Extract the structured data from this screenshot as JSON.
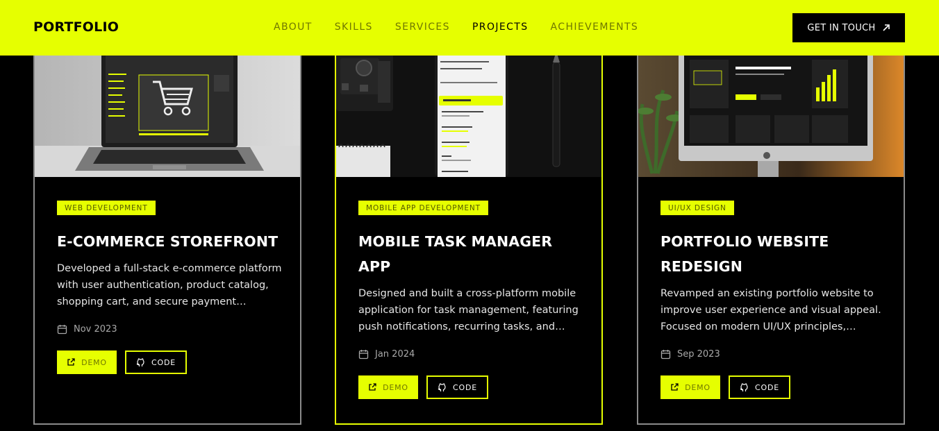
{
  "header": {
    "logo": "PORTFOLIO",
    "nav": [
      {
        "label": "ABOUT",
        "active": false
      },
      {
        "label": "SKILLS",
        "active": false
      },
      {
        "label": "SERVICES",
        "active": false
      },
      {
        "label": "PROJECTS",
        "active": true
      },
      {
        "label": "ACHIEVEMENTS",
        "active": false
      }
    ],
    "cta_label": "GET IN TOUCH",
    "cta_icon": "arrow-up-right-icon"
  },
  "colors": {
    "accent": "#e6ff00",
    "background": "#000000",
    "card_border": "#8b8b8b",
    "muted_accent_text": "#6f7700"
  },
  "projects": [
    {
      "tag": "WEB DEVELOPMENT",
      "title": "E-COMMERCE STOREFRONT",
      "description": "Developed a full-stack e-commerce platform with user authentication, product catalog, shopping cart, and secure payment gateway integration.",
      "date": "Nov 2023",
      "demo_label": "DEMO",
      "code_label": "CODE",
      "highlighted": false,
      "image_subject": "laptop with shopping cart screen"
    },
    {
      "tag": "MOBILE APP DEVELOPMENT",
      "title": "MOBILE TASK MANAGER APP",
      "description": "Designed and built a cross-platform mobile application for task management, featuring push notifications, recurring tasks, and offline support.",
      "date": "Jan 2024",
      "demo_label": "DEMO",
      "code_label": "CODE",
      "highlighted": true,
      "image_subject": "smartphone with task list app"
    },
    {
      "tag": "UI/UX DESIGN",
      "title": "PORTFOLIO WEBSITE REDESIGN",
      "description": "Revamped an existing portfolio website to improve user experience and visual appeal. Focused on modern UI/UX principles, accessibility and responsiveness.",
      "date": "Sep 2023",
      "demo_label": "DEMO",
      "code_label": "CODE",
      "highlighted": false,
      "image_subject": "desktop monitor with dashboard design"
    }
  ],
  "icons": {
    "date": "calendar-icon",
    "demo": "external-link-icon",
    "code": "github-icon"
  }
}
